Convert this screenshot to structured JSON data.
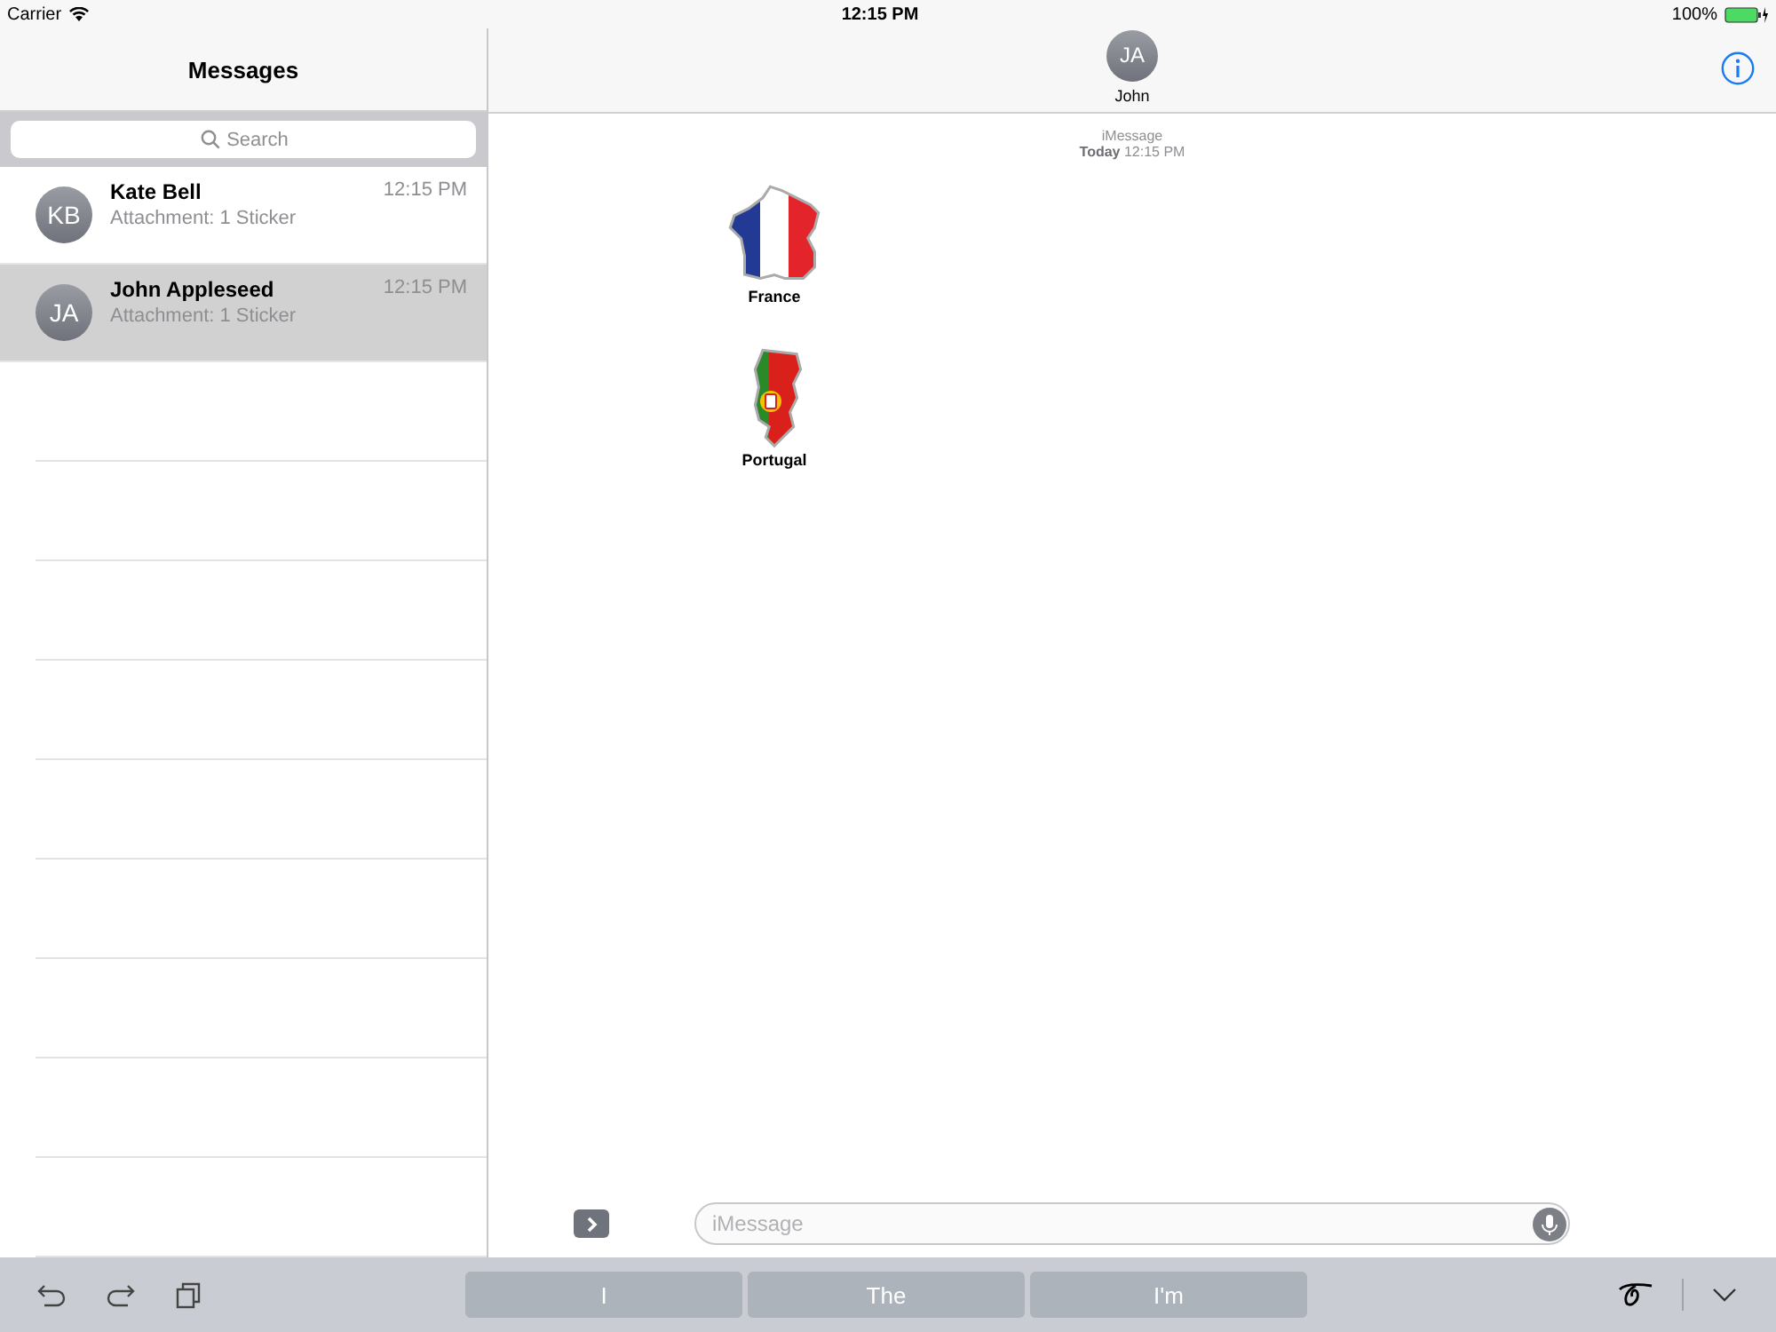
{
  "status_bar": {
    "carrier": "Carrier",
    "time": "12:15 PM",
    "battery": "100%"
  },
  "sidebar": {
    "title": "Messages",
    "search": {
      "placeholder": "Search"
    },
    "conversations": [
      {
        "initials": "KB",
        "name": "Kate Bell",
        "time": "12:15 PM",
        "preview": "Attachment: 1 Sticker",
        "selected": false
      },
      {
        "initials": "JA",
        "name": "John Appleseed",
        "time": "12:15 PM",
        "preview": "Attachment: 1 Sticker",
        "selected": true
      }
    ]
  },
  "chat": {
    "contact": {
      "initials": "JA",
      "name": "John"
    },
    "service": "iMessage",
    "timestamp": "**Today** 12:15 PM",
    "stickers": [
      {
        "kind": "france",
        "caption": "France"
      },
      {
        "kind": "portugal",
        "caption": "Portugal"
      }
    ],
    "input": {
      "placeholder": "iMessage"
    }
  },
  "keyboard_bar": {
    "suggestions": [
      "I",
      "The",
      "I'm"
    ]
  }
}
